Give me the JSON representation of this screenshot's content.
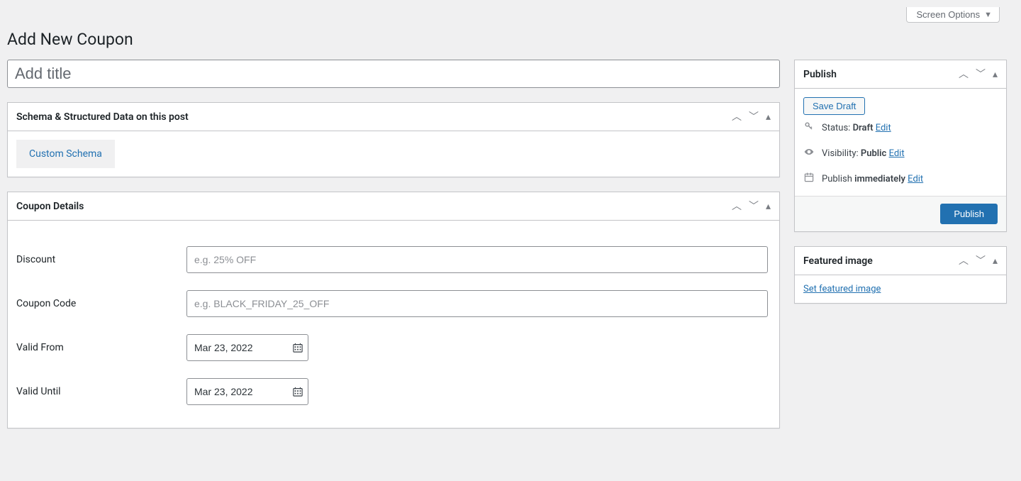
{
  "screen_options_label": "Screen Options",
  "page_title": "Add New Coupon",
  "title_placeholder": "Add title",
  "schema_box": {
    "title": "Schema & Structured Data on this post",
    "tab_label": "Custom Schema"
  },
  "coupon_box": {
    "title": "Coupon Details",
    "fields": {
      "discount": {
        "label": "Discount",
        "placeholder": "e.g. 25% OFF",
        "value": ""
      },
      "code": {
        "label": "Coupon Code",
        "placeholder": "e.g. BLACK_FRIDAY_25_OFF",
        "value": ""
      },
      "valid_from": {
        "label": "Valid From",
        "value": "Mar 23, 2022"
      },
      "valid_until": {
        "label": "Valid Until",
        "value": "Mar 23, 2022"
      }
    }
  },
  "publish_box": {
    "title": "Publish",
    "save_draft_label": "Save Draft",
    "status_label": "Status:",
    "status_value": "Draft",
    "visibility_label": "Visibility:",
    "visibility_value": "Public",
    "publish_label": "Publish",
    "publish_value": "immediately",
    "edit_label": "Edit",
    "publish_button": "Publish"
  },
  "featured_box": {
    "title": "Featured image",
    "link_label": "Set featured image"
  }
}
